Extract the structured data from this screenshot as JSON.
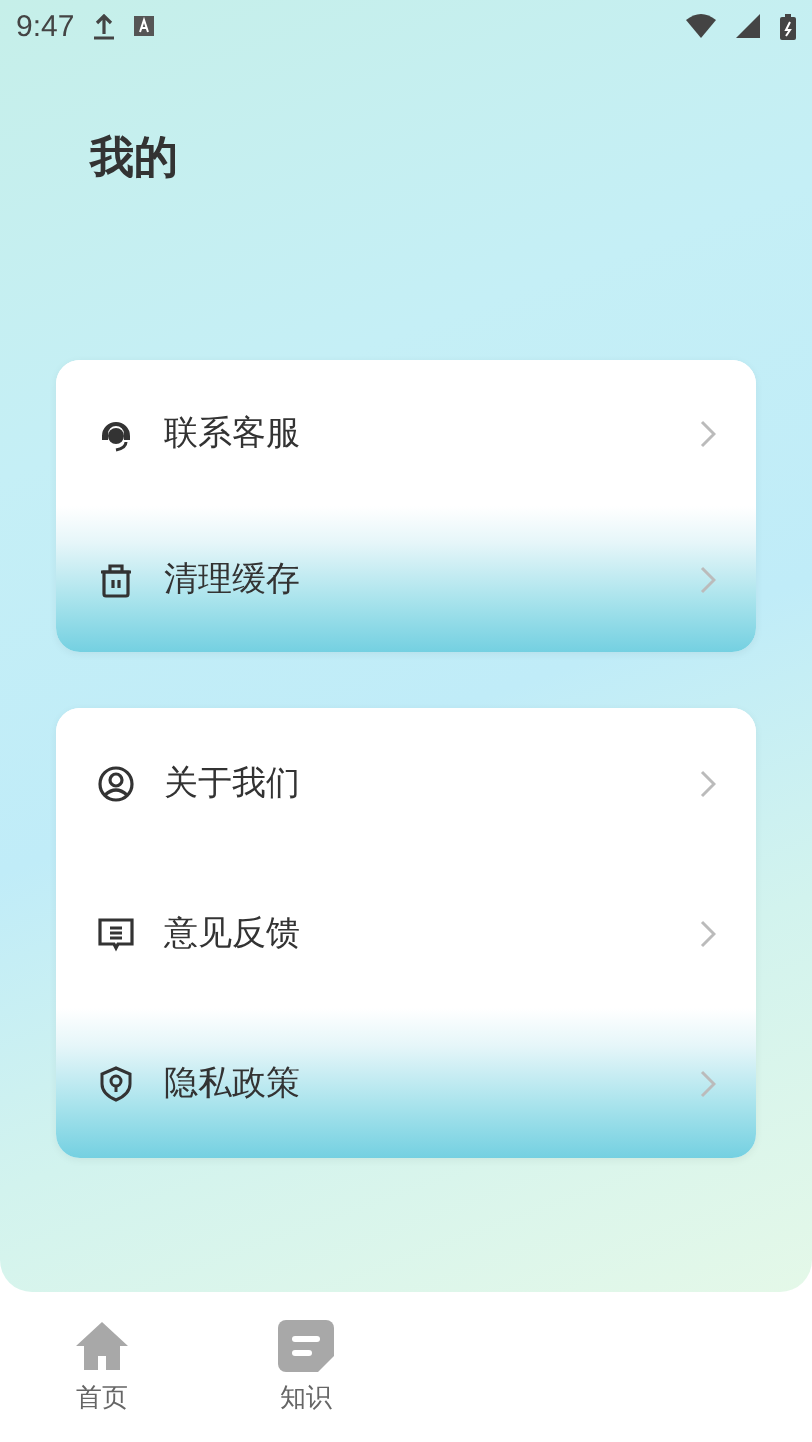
{
  "status_bar": {
    "time": "9:47"
  },
  "title": "我的",
  "groups": [
    {
      "items": [
        {
          "label": "联系客服",
          "kind": "headset",
          "selected": false
        },
        {
          "label": "清理缓存",
          "kind": "trash",
          "selected": true
        }
      ]
    },
    {
      "items": [
        {
          "label": "关于我们",
          "kind": "user",
          "selected": false
        },
        {
          "label": "意见反馈",
          "kind": "feedback",
          "selected": false
        },
        {
          "label": "隐私政策",
          "kind": "shield",
          "selected": true
        }
      ]
    }
  ],
  "tabs": [
    {
      "label": "首页",
      "kind": "home",
      "selected": false
    },
    {
      "label": "知识",
      "kind": "doc",
      "selected": false
    }
  ]
}
